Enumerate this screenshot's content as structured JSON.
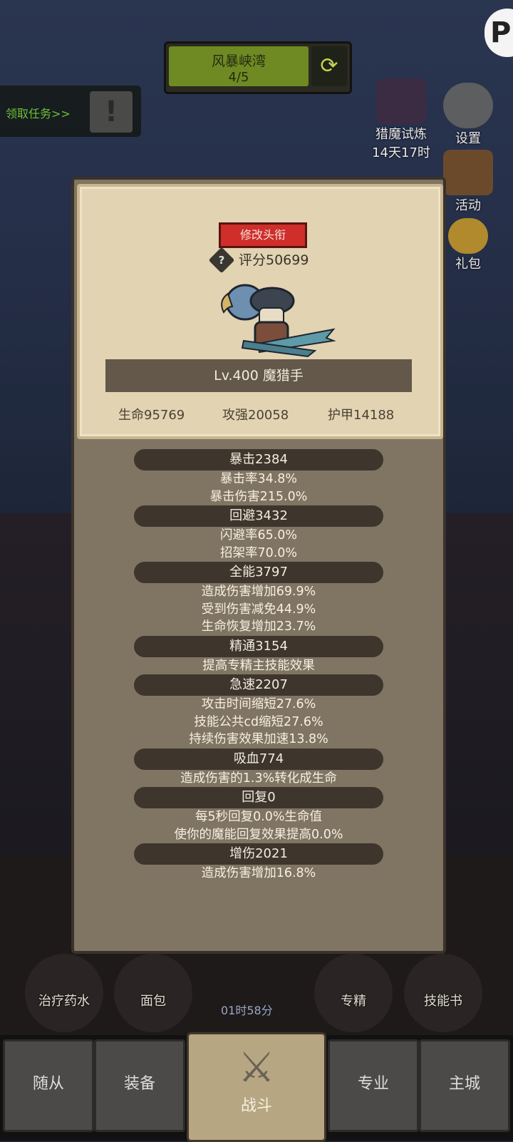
{
  "hud": {
    "stage_name": "风暴峡湾",
    "stage_progress": "4/5",
    "quest_label": "领取任务>>",
    "hunt_trial_label": "猎魔试炼",
    "hunt_trial_time": "14天17时",
    "settings_label": "设置",
    "activity_label": "活动",
    "gift_label": "礼包"
  },
  "dialog": {
    "title_button": "修改头衔",
    "score": "评分50699",
    "level_name": "Lv.400 魔猎手",
    "stats": {
      "hp": "生命95769",
      "attack": "攻强20058",
      "armor": "护甲14188"
    },
    "sections": [
      {
        "header": "暴击2384",
        "lines": [
          "暴击率34.8%",
          "暴击伤害215.0%"
        ]
      },
      {
        "header": "回避3432",
        "lines": [
          "闪避率65.0%",
          "招架率70.0%"
        ]
      },
      {
        "header": "全能3797",
        "lines": [
          "造成伤害增加69.9%",
          "受到伤害减免44.9%",
          "生命恢复增加23.7%"
        ]
      },
      {
        "header": "精通3154",
        "lines": [
          "提高专精主技能效果"
        ]
      },
      {
        "header": "急速2207",
        "lines": [
          "攻击时间缩短27.6%",
          "技能公共cd缩短27.6%",
          "持续伤害效果加速13.8%"
        ]
      },
      {
        "header": "吸血774",
        "lines": [
          "造成伤害的1.3%转化成生命"
        ]
      },
      {
        "header": "回复0",
        "lines": [
          "每5秒回复0.0%生命值",
          "使你的魔能回复效果提高0.0%"
        ]
      },
      {
        "header": "增伤2021",
        "lines": [
          "造成伤害增加16.8%"
        ]
      }
    ]
  },
  "consumables": [
    "治疗药水",
    "面包",
    "专精",
    "技能书"
  ],
  "timer": "01时58分",
  "tabs": [
    "随从",
    "装备",
    "战斗",
    "专业",
    "主城"
  ],
  "colors": {
    "title_button": "#cf2e2a",
    "stage_bar": "#6f8a22",
    "quest_text": "#6cc13a",
    "card_bg": "#e2d3b2",
    "dialog_bg": "#807463"
  }
}
